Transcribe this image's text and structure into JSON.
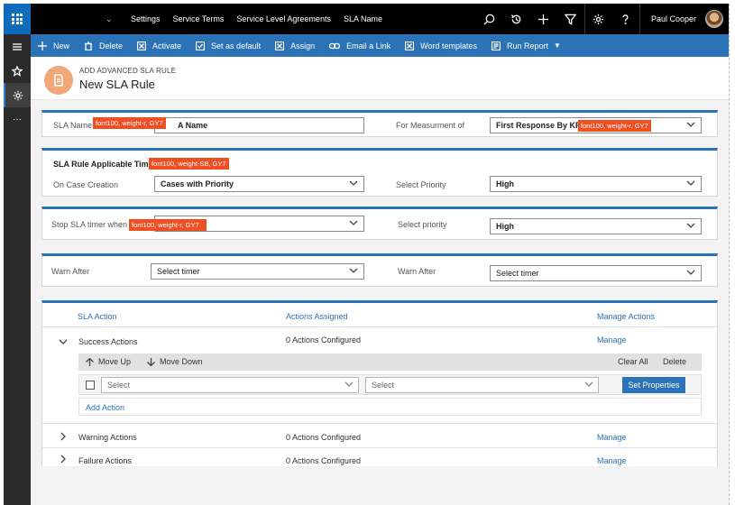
{
  "topnav": {
    "links": [
      "Settings",
      "Service Terms",
      "Service Level Agreements",
      "SLA Name"
    ],
    "user_name": "Paul Cooper"
  },
  "commands": [
    {
      "label": "New",
      "icon": "plus-icon"
    },
    {
      "label": "Delete",
      "icon": "trash-icon"
    },
    {
      "label": "Activate",
      "icon": "activate-icon"
    },
    {
      "label": "Set as default",
      "icon": "set-default-icon"
    },
    {
      "label": "Assign",
      "icon": "assign-icon"
    },
    {
      "label": "Email a Link",
      "icon": "link-icon"
    },
    {
      "label": "Word templates",
      "icon": "word-icon"
    },
    {
      "label": "Run Report",
      "icon": "report-icon"
    }
  ],
  "header": {
    "entity_type": "ADD ADVANCED SLA RULE",
    "title": "New SLA Rule"
  },
  "sla_name": {
    "label": "SLA Name",
    "value": "A Name",
    "annotation": "font100, weight-r, GY7"
  },
  "measurement": {
    "label": "For Measurment of",
    "value": "First Response By KPI",
    "annotation": "font100, weight-r, GY7"
  },
  "applicable_time": {
    "heading": "SLA Rule Applicable Time",
    "heading_annotation": "font100, weight-SB, GY7",
    "on_case_label": "On Case Creation",
    "on_case_value": "Cases with Priority",
    "priority_label": "Select Priority",
    "priority_value": "High"
  },
  "stop_timer": {
    "label": "Stop SLA timer when",
    "annotation": "font100, weight-r, GY7",
    "priority_label": "Select priority",
    "priority_value": "High"
  },
  "warn": {
    "label_left": "Warn After",
    "value_left": "Select timer",
    "label_right": "Warn After",
    "value_right": "Select timer"
  },
  "sla_actions": {
    "col_action": "SLA Action",
    "col_assigned": "Actions Assigned",
    "col_manage": "Manage Actions",
    "rows": [
      {
        "name": "Success Actions",
        "assigned": "0 Actions Configured",
        "manage": "Manage",
        "expanded": true
      },
      {
        "name": "Warning Actions",
        "assigned": "0 Actions Configured",
        "manage": "Manage",
        "expanded": false
      },
      {
        "name": "Failure Actions",
        "assigned": "0 Actions Configured",
        "manage": "Manage",
        "expanded": false
      }
    ],
    "subbar": {
      "move_up": "Move Up",
      "move_down": "Move Down",
      "clear_all": "Clear All",
      "delete": "Delete"
    },
    "select_1": "Select",
    "select_2": "Select",
    "set_properties": "Set Properties",
    "add_action": "Add Action"
  }
}
